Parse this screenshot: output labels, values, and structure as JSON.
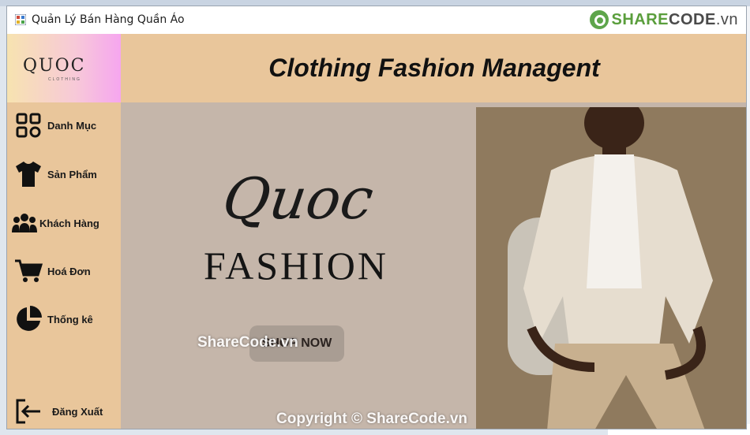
{
  "window": {
    "title": "Quản Lý Bán Hàng Quần Áo",
    "watermark_logo": {
      "part1": "SHARE",
      "part2": "CODE",
      "part3": ".vn"
    }
  },
  "sidebar": {
    "logo_text": "QUOC",
    "logo_subtext": "CLOTHING",
    "items": [
      {
        "label": "Danh Mục",
        "icon": "grid-icon"
      },
      {
        "label": "Sản Phẩm",
        "icon": "tshirt-icon"
      },
      {
        "label": "Khách Hàng",
        "icon": "users-icon"
      },
      {
        "label": "Hoá Đơn",
        "icon": "cart-icon"
      },
      {
        "label": "Thống kê",
        "icon": "pie-chart-icon"
      }
    ],
    "logout_label": "Đăng Xuất"
  },
  "header": {
    "title": "Clothing Fashion Managent"
  },
  "banner": {
    "script_text": "Quoc",
    "brand_text": "FASHION",
    "button_label": "SHOP NOW",
    "watermark_top": "ShareCode.vn",
    "watermark_bottom": "Copyright © ShareCode.vn"
  },
  "colors": {
    "sidebar_bg": "#e9c69b",
    "banner_bg": "#c5b6aa",
    "accent_green": "#5a9e3c"
  }
}
